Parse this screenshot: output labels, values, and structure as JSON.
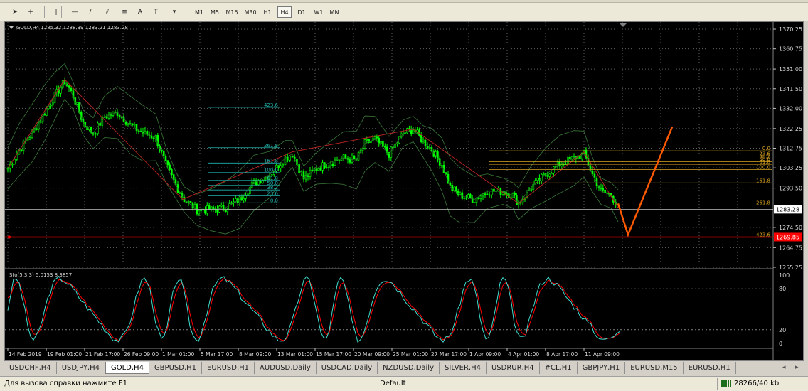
{
  "toolbar": {
    "tools": [
      {
        "name": "cursor-icon",
        "glyph": "➤"
      },
      {
        "name": "crosshair-icon",
        "glyph": "+"
      },
      {
        "name": "vertical-line-icon",
        "glyph": "|"
      },
      {
        "name": "horizontal-line-icon",
        "glyph": "—"
      },
      {
        "name": "trendline-icon",
        "glyph": "/"
      },
      {
        "name": "channel-icon",
        "glyph": "⫽"
      },
      {
        "name": "fibo-icon",
        "glyph": "≡"
      },
      {
        "name": "text-icon",
        "glyph": "A"
      },
      {
        "name": "label-icon",
        "glyph": "T"
      },
      {
        "name": "objects-menu-icon",
        "glyph": "▾"
      }
    ],
    "timeframes": [
      "M1",
      "M5",
      "M15",
      "M30",
      "H1",
      "H4",
      "D1",
      "W1",
      "MN"
    ],
    "active_timeframe": "H4"
  },
  "chart": {
    "header": "GOLD,H4  1285.32 1288.39 1283.21 1283.28",
    "price_labels": [
      "1370.25",
      "1360.75",
      "1351.00",
      "1341.50",
      "1332.00",
      "1322.25",
      "1312.75",
      "1303.25",
      "1293.50",
      "1283.28",
      "1274.50",
      "1264.75",
      "1255.25"
    ],
    "current_price": "1283.28",
    "target_price": "1269.85",
    "time_labels": [
      "14 Feb 2019",
      "19 Feb 01:00",
      "21 Feb 17:00",
      "26 Feb 09:00",
      "1 Mar 01:00",
      "5 Mar 17:00",
      "8 Mar 09:00",
      "13 Mar 01:00",
      "15 Mar 17:00",
      "20 Mar 09:00",
      "25 Mar 01:00",
      "27 Mar 17:00",
      "1 Apr 09:00",
      "4 Apr 01:00",
      "8 Apr 17:00",
      "11 Apr 09:00"
    ],
    "fibo_left": [
      "423.6",
      "261.8",
      "161.8",
      "100.0",
      "61.8",
      "50.0",
      "38.2",
      "23.6",
      "0.0"
    ],
    "fibo_right": [
      "0.0",
      "23.6",
      "38.2",
      "50.0",
      "61.8",
      "100.0",
      "161.8",
      "261.8",
      "423.6"
    ],
    "osc_header": "Sto(5,3,3) 5.0153 8.3857",
    "osc_labels": [
      "100",
      "80",
      "20",
      "0"
    ],
    "colors": {
      "candle": "#00ff00",
      "fibo_left": "#20b2aa",
      "fibo_right": "#daa520",
      "forecast": "#ff5a00",
      "target_line": "#ff0000",
      "stoch_main": "#40e0d0",
      "stoch_signal": "#ff0000"
    }
  },
  "tabs": [
    "USDCHF,H4",
    "USDJPY,H4",
    "GOLD,H4",
    "GBPUSD,H1",
    "EURUSD,H1",
    "AUDUSD,Daily",
    "USDCAD,Daily",
    "NZDUSD,Daily",
    "SILVER,H4",
    "USDRUR,H4",
    "#CL,H1",
    "GBPJPY,H1",
    "EURUSD,M15",
    "EURUSD,H1"
  ],
  "active_tab": "GOLD,H4",
  "status": {
    "help": "Для вызова справки нажмите F1",
    "profile": "Default",
    "traffic": "28266/40 kb"
  }
}
